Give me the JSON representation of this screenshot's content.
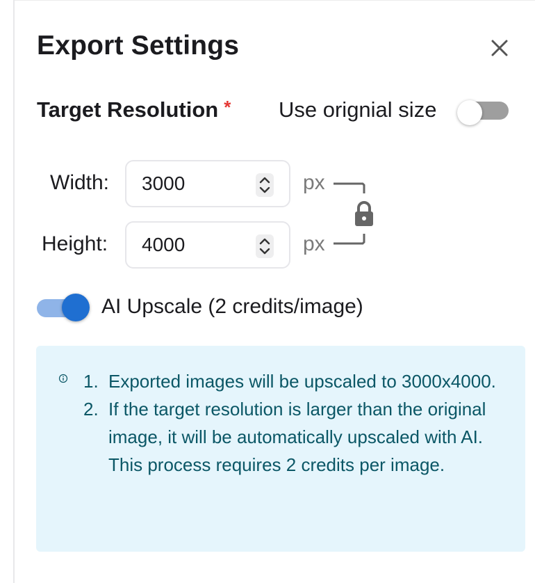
{
  "dialog": {
    "title": "Export Settings"
  },
  "resolution": {
    "label": "Target Resolution",
    "required_mark": "*",
    "use_original_label": "Use orignial size",
    "use_original_on": false,
    "width_label": "Width:",
    "width_value": "3000",
    "height_label": "Height:",
    "height_value": "4000",
    "unit": "px",
    "aspect_locked": true
  },
  "upscale": {
    "label": "AI Upscale (2 credits/image)",
    "enabled": true
  },
  "info": {
    "items": [
      {
        "num": "1.",
        "text": "Exported images will be upscaled to 3000x4000."
      },
      {
        "num": "2.",
        "text": "If the target resolution is larger than the original image, it will be automatically upscaled with AI. This process requires 2 credits per image."
      }
    ]
  },
  "icons": {
    "close": "close-icon",
    "stepper": "chevron-up-down-icon",
    "lock": "lock-icon",
    "info": "info-circle-icon"
  },
  "colors": {
    "required": "#e53935",
    "toggle_on_thumb": "#1f6fd1",
    "toggle_on_track": "#8fb4e8",
    "toggle_off_track": "#9e9e9e",
    "info_background": "#e5f5fc",
    "info_text": "#0b5766"
  }
}
